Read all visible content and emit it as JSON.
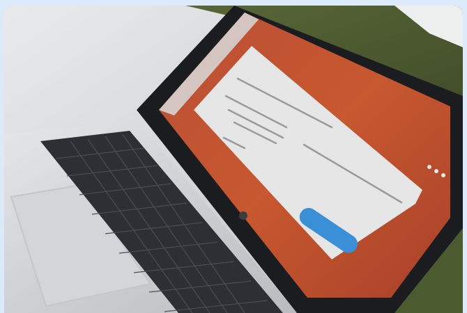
{
  "photo": {
    "subject": "laptop-on-desk",
    "screen_color": "#c7582f",
    "dialog_color": "#e6e6e6",
    "button_color": "#3a8fd6",
    "frame_color": "#dbe9f8"
  }
}
